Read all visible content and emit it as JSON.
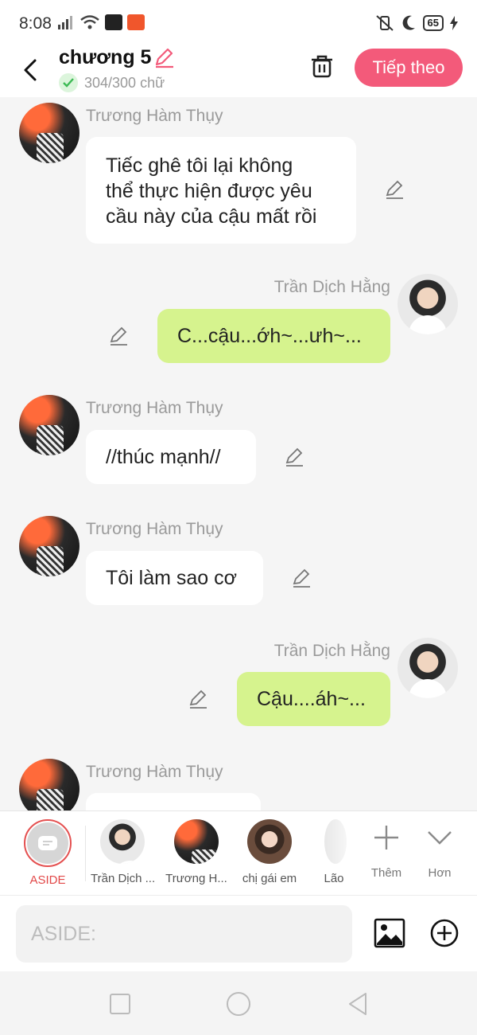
{
  "status_bar": {
    "time": "8:08",
    "battery": "65"
  },
  "header": {
    "title": "chương 5",
    "word_count": "304/300 chữ",
    "next_label": "Tiếp theo"
  },
  "messages": [
    {
      "side": "left",
      "name": "Trương Hàm Thụy",
      "lines": [
        "Tiếc ghê tôi lại không",
        "thể thực hiện được yêu",
        "cầu này của cậu mất rồi"
      ]
    },
    {
      "side": "right",
      "name": "Trần Dịch Hằng",
      "lines": [
        "C...cậu...ớh~...ưh~..."
      ]
    },
    {
      "side": "left",
      "name": "Trương Hàm Thụy",
      "lines": [
        "//thúc mạnh//"
      ]
    },
    {
      "side": "left",
      "name": "Trương Hàm Thụy",
      "lines": [
        "Tôi làm sao cơ"
      ]
    },
    {
      "side": "right",
      "name": "Trần Dịch Hằng",
      "lines": [
        "Cậu....áh~..."
      ]
    },
    {
      "side": "left",
      "name": "Trương Hàm Thụy",
      "lines": [
        ""
      ]
    }
  ],
  "characters": {
    "aside": "ASIDE",
    "items": [
      {
        "label": "Trần Dịch ..."
      },
      {
        "label": "Trương H..."
      },
      {
        "label": "chị gái em"
      },
      {
        "label": "Lão"
      }
    ],
    "add_label": "Thêm",
    "more_label": "Hơn"
  },
  "input": {
    "placeholder": "ASIDE:",
    "value": ""
  },
  "colors": {
    "accent": "#f35a7a",
    "bubble_right": "#d6f38e",
    "bubble_left": "#ffffff",
    "aside_red": "#e24848"
  },
  "icons": [
    "back-icon",
    "edit-icon",
    "check-icon",
    "trash-icon",
    "pencil-icon",
    "aside-icon",
    "plus-icon",
    "chevron-down-icon",
    "image-icon",
    "add-circle-icon",
    "nav-square-icon",
    "nav-circle-icon",
    "nav-back-icon"
  ]
}
